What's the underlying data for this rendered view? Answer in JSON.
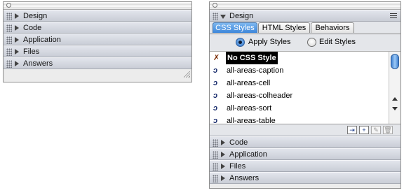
{
  "left_panel": {
    "sections": [
      {
        "label": "Design"
      },
      {
        "label": "Code"
      },
      {
        "label": "Application"
      },
      {
        "label": "Files"
      },
      {
        "label": "Answers"
      }
    ]
  },
  "right_panel": {
    "design": {
      "label": "Design",
      "tabs": [
        "CSS Styles",
        "HTML Styles",
        "Behaviors"
      ],
      "active_tab": "CSS Styles",
      "radio_apply": "Apply Styles",
      "radio_edit": "Edit Styles",
      "radio_selected": "Apply Styles",
      "styles": [
        {
          "label": "No CSS Style",
          "icon": "no-style-icon",
          "selected": true
        },
        {
          "label": "all-areas-caption",
          "icon": "css-style-icon"
        },
        {
          "label": "all-areas-cell",
          "icon": "css-style-icon"
        },
        {
          "label": "all-areas-colheader",
          "icon": "css-style-icon"
        },
        {
          "label": "all-areas-sort",
          "icon": "css-style-icon"
        },
        {
          "label": "all-areas-table",
          "icon": "css-style-icon"
        }
      ]
    },
    "sections": [
      {
        "label": "Code"
      },
      {
        "label": "Application"
      },
      {
        "label": "Files"
      },
      {
        "label": "Answers"
      }
    ]
  },
  "colors": {
    "active_tab": "#3c86db",
    "selection": "#000000",
    "scroll_thumb": "#3f7fd0"
  }
}
